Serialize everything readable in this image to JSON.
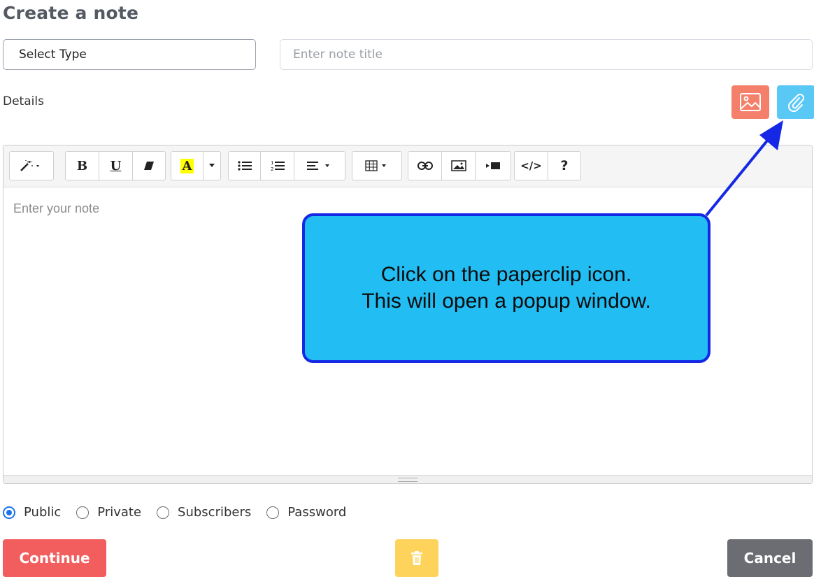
{
  "page": {
    "title": "Create a note"
  },
  "form": {
    "select_type_label": "Select Type",
    "note_title_placeholder": "Enter note title",
    "details_label": "Details",
    "editor_placeholder": "Enter your note"
  },
  "toolbar": {
    "bold_label": "B",
    "underline_label": "U",
    "highlight_label": "A",
    "code_label": "</>",
    "help_label": "?"
  },
  "visibility": {
    "options": [
      "Public",
      "Private",
      "Subscribers",
      "Password"
    ],
    "selected": "Public"
  },
  "actions": {
    "continue_label": "Continue",
    "cancel_label": "Cancel"
  },
  "callout": {
    "line1": "Click on the paperclip icon.",
    "line2": "This will open a popup window."
  },
  "colors": {
    "image_button": "#f4806b",
    "paperclip_button": "#5ac8f5",
    "continue_button": "#f25e5e",
    "delete_button": "#fdd35b",
    "cancel_button": "#6c6d72",
    "callout_fill": "#22bdf3",
    "callout_border": "#1428e6"
  },
  "icons": [
    "image-icon",
    "paperclip-icon",
    "magic-wand-icon",
    "eraser-icon",
    "bullet-list-icon",
    "numbered-list-icon",
    "align-icon",
    "table-icon",
    "link-icon",
    "picture-icon",
    "video-icon",
    "trash-icon"
  ]
}
